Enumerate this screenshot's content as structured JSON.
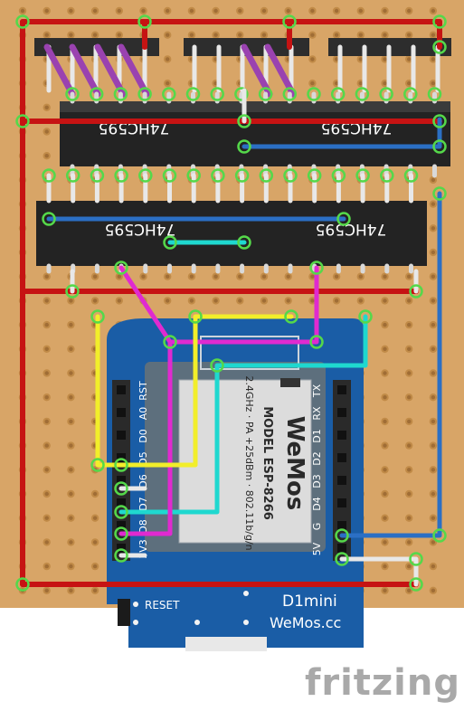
{
  "diagram": {
    "ic_top_label": "74HC595",
    "ic_bottom_label": "74HC595",
    "module_pins_left": [
      "RST",
      "A0",
      "D0",
      "D5",
      "D6",
      "D7",
      "D8",
      "3V3"
    ],
    "module_pins_right": [
      "TX",
      "RX",
      "D1",
      "D2",
      "D3",
      "D4",
      "G",
      "5V"
    ],
    "module_shield_model": "MODEL ESP-8266",
    "module_shield_brand": "WeMos",
    "module_shield_specs": "2.4GHz · PA +25dBm · 802.11b/g/n",
    "reset_label": "RESET",
    "board_name": "D1mini",
    "board_brand": "WeMos.cc",
    "watermark": "fritzing"
  },
  "colors": {
    "stripboard": "#d8a567",
    "rail_red": "#c61313",
    "wire_blue": "#2b6fc4",
    "wire_yellow": "#f2ee2a",
    "wire_magenta": "#e02ad0",
    "wire_cyan": "#1fd8cf",
    "wire_purple": "#9a42b0",
    "ic_body": "#2b2b2b",
    "module_blue": "#1a5da6"
  }
}
